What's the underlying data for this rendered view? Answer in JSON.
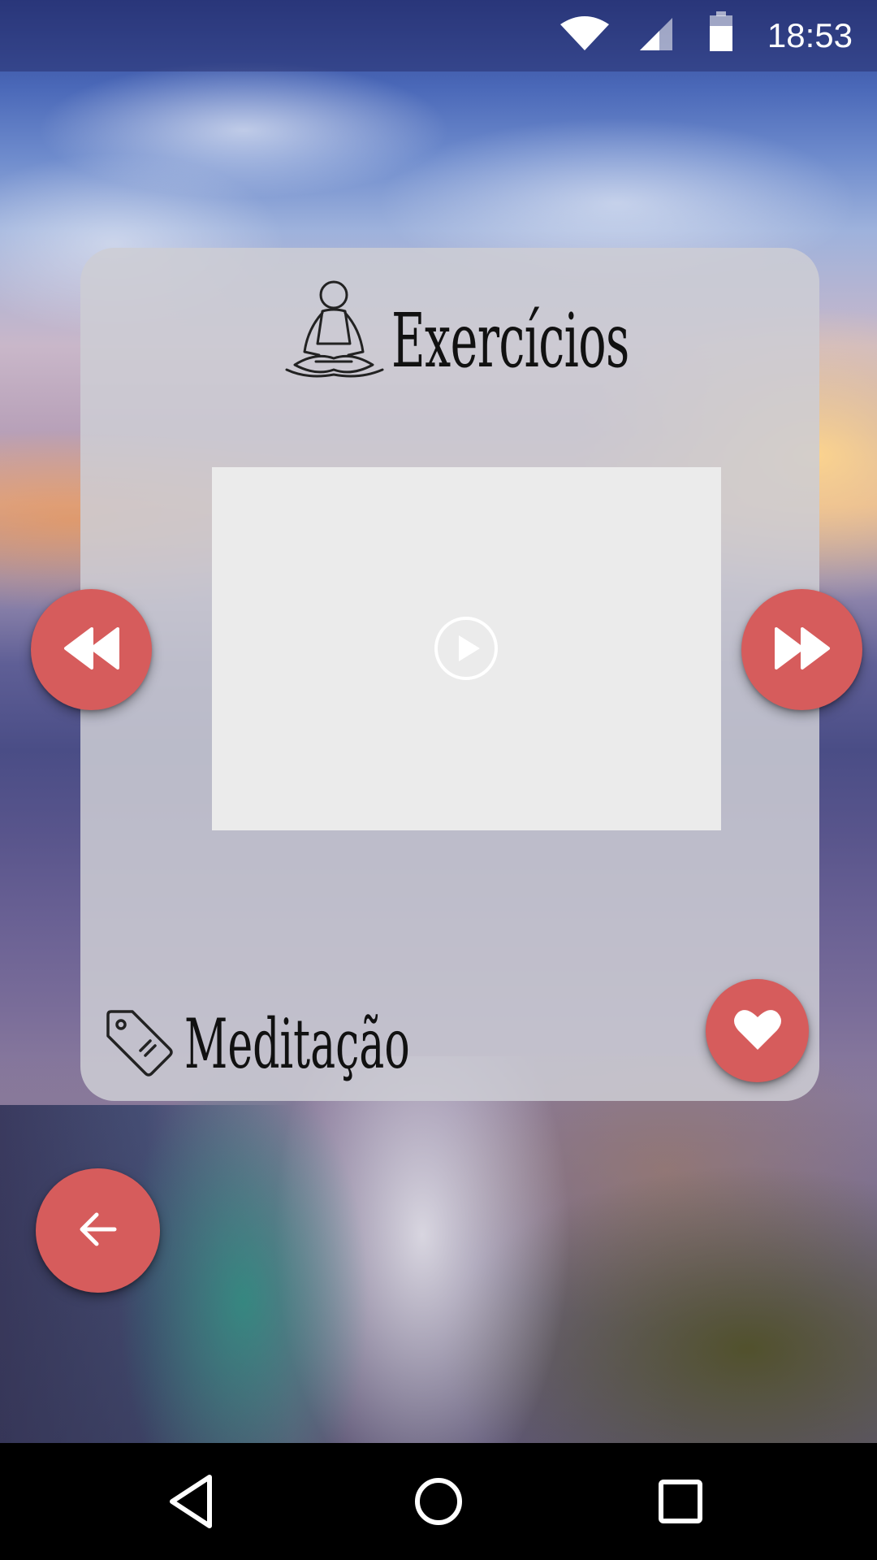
{
  "status_bar": {
    "time": "18:53",
    "icons": [
      "wifi-icon",
      "cell-signal-icon",
      "battery-icon"
    ]
  },
  "card": {
    "title": "Exercícios",
    "title_icon": "meditation-person-icon",
    "video": {
      "play_icon": "play-circle-icon"
    },
    "category_icon": "tag-icon",
    "category": "Meditação"
  },
  "controls": {
    "previous_icon": "rewind-icon",
    "next_icon": "fast-forward-icon",
    "favorite_icon": "heart-icon",
    "back_icon": "arrow-left-icon"
  },
  "nav_bar": {
    "icons": [
      "nav-back-icon",
      "nav-home-icon",
      "nav-recents-icon"
    ]
  },
  "colors": {
    "accent": "#d65c5c",
    "card_bg": "#cdcdd4",
    "video_bg": "#ebebeb"
  }
}
